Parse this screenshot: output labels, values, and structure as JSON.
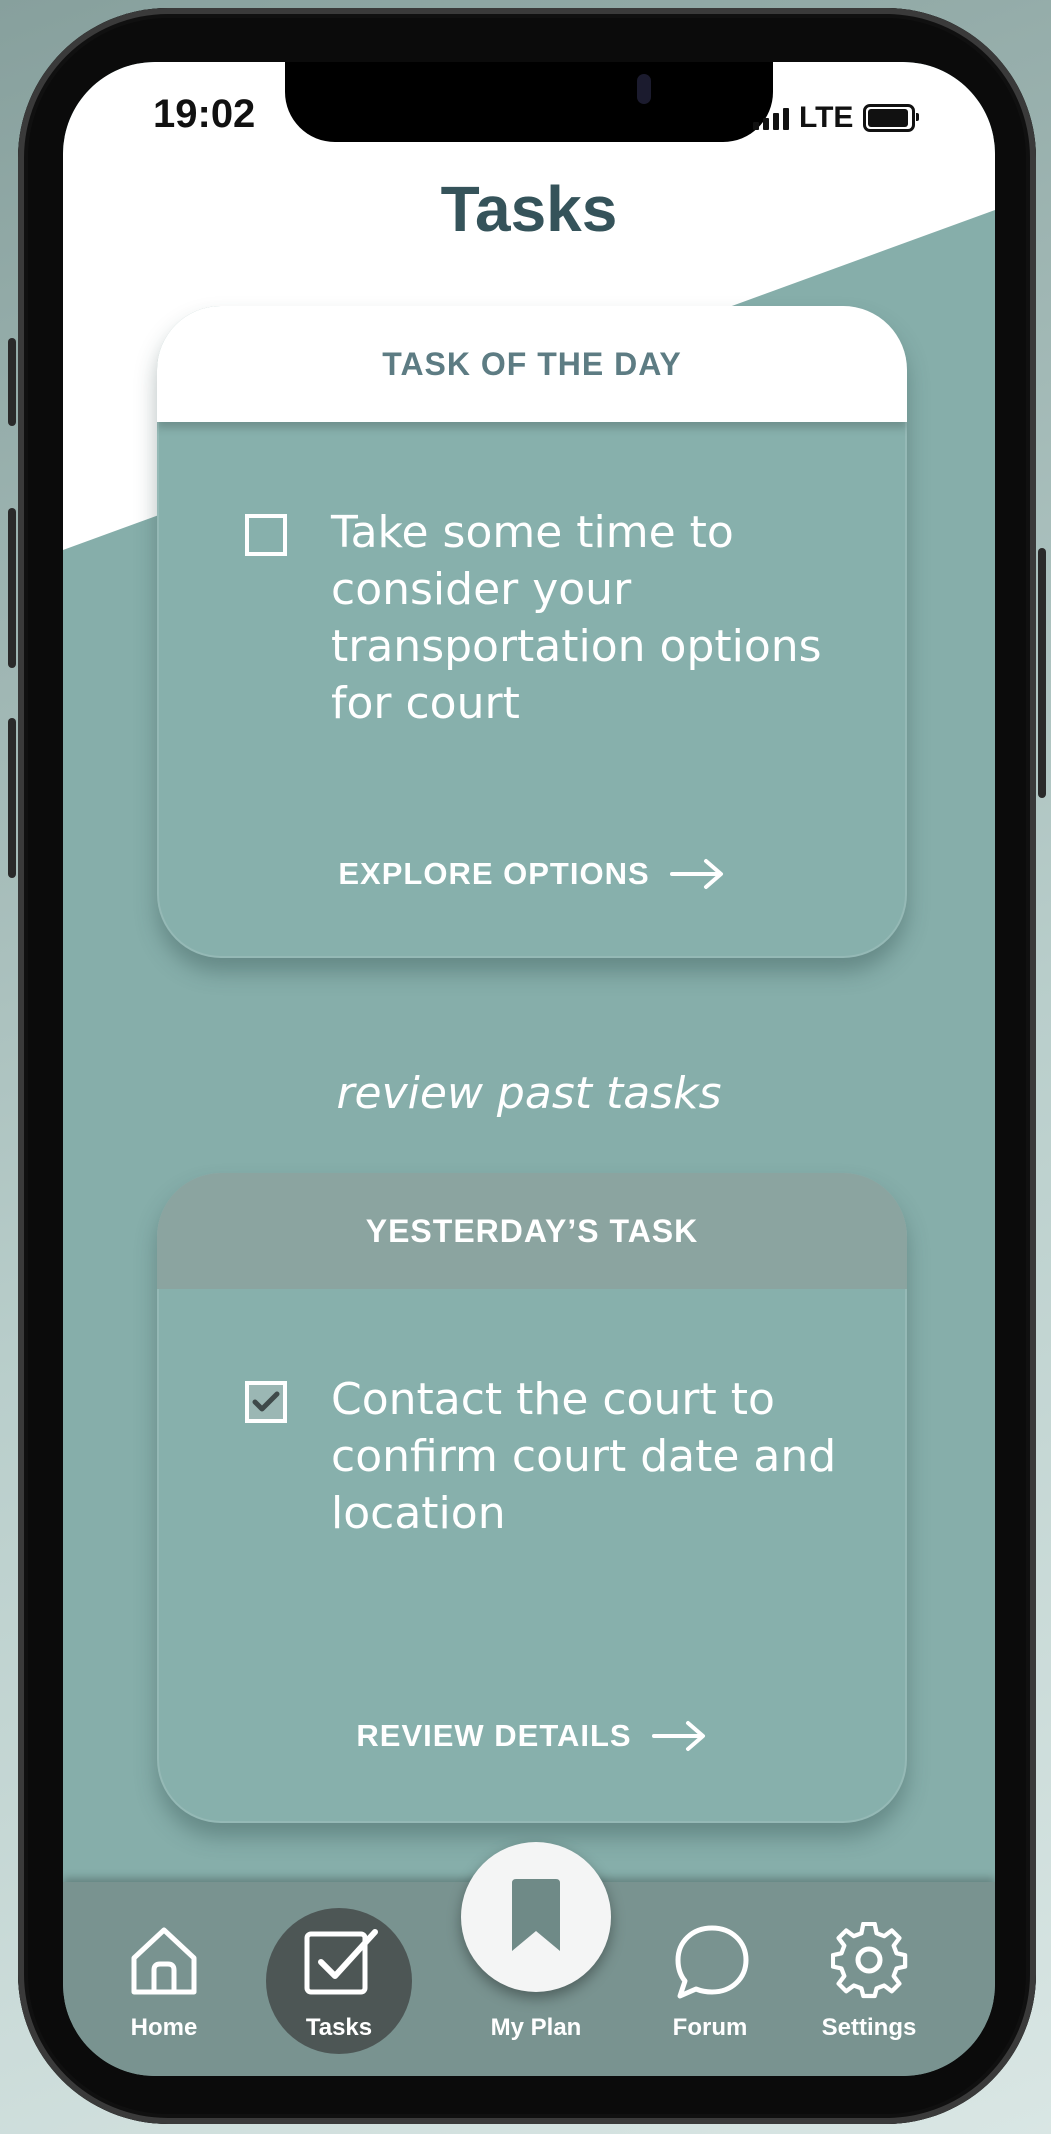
{
  "status_bar": {
    "time": "19:02",
    "network": "LTE"
  },
  "page": {
    "title": "Tasks"
  },
  "task_of_day": {
    "header": "TASK OF THE DAY",
    "text": "Take some time to consider your transportation options for court",
    "checked": false,
    "action_label": "EXPLORE OPTIONS"
  },
  "review_label": "review past tasks",
  "yesterday_task": {
    "header": "YESTERDAY’S TASK",
    "text": "Contact the court to confirm court date and location",
    "checked": true,
    "action_label": "REVIEW DETAILS"
  },
  "tabbar": {
    "home": "Home",
    "tasks": "Tasks",
    "my_plan": "My Plan",
    "forum": "Forum",
    "settings": "Settings",
    "active": "Tasks"
  },
  "colors": {
    "teal": "#86aeaa",
    "title": "#35535a",
    "tabbar": "#799390",
    "active_tab": "#4d5655"
  }
}
